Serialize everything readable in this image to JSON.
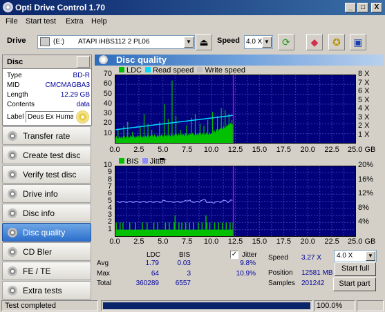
{
  "window": {
    "title": "Opti Drive Control 1.70",
    "min_label": "_",
    "max_label": "□",
    "close_label": "X"
  },
  "menu": [
    "File",
    "Start test",
    "Extra",
    "Help"
  ],
  "toolbar": {
    "drive_label": "Drive",
    "drive_letter": "(E:)",
    "drive_name": "ATAPI  iHBS112   2 PL06",
    "speed_label": "Speed",
    "speed_value": "4.0 X"
  },
  "disc": {
    "header": "Disc",
    "rows": [
      {
        "k": "Type",
        "v": "BD-R"
      },
      {
        "k": "MID",
        "v": "CMCMAGBA3"
      },
      {
        "k": "Length",
        "v": "12.29 GB"
      },
      {
        "k": "Contents",
        "v": "data"
      }
    ],
    "label_caption": "Label",
    "label_value": "Deus Ex Huma"
  },
  "nav": [
    {
      "label": "Transfer rate",
      "active": false
    },
    {
      "label": "Create test disc",
      "active": false
    },
    {
      "label": "Verify test disc",
      "active": false
    },
    {
      "label": "Drive info",
      "active": false
    },
    {
      "label": "Disc info",
      "active": false
    },
    {
      "label": "Disc quality",
      "active": true
    },
    {
      "label": "CD Bler",
      "active": false
    },
    {
      "label": "FE / TE",
      "active": false
    },
    {
      "label": "Extra tests",
      "active": false
    }
  ],
  "panel_title": "Disc quality",
  "colors": {
    "chart_bg": "#00007a",
    "ldc": "#00c000",
    "read": "#00d8ff",
    "write": "#c0c0c0",
    "bis": "#00c000",
    "jitter": "#8c8cff",
    "marker": "#d000d0",
    "grid": "#3a3ab0"
  },
  "chart_data": [
    {
      "type": "bar",
      "legend": [
        {
          "name": "LDC"
        },
        {
          "name": "Read speed"
        },
        {
          "name": "Write speed"
        }
      ],
      "x_range": [
        0,
        25
      ],
      "x_ticks": [
        "0.0",
        "2.5",
        "5.0",
        "7.5",
        "10.0",
        "12.5",
        "15.0",
        "17.5",
        "20.0",
        "22.5",
        "25.0 GB"
      ],
      "y_range": [
        0,
        70
      ],
      "y_ticks": [
        "70",
        "60",
        "50",
        "40",
        "30",
        "20",
        "10"
      ],
      "y2_range": [
        0,
        8
      ],
      "y2_ticks": [
        "8 X",
        "7 X",
        "6 X",
        "5 X",
        "4 X",
        "3 X",
        "2 X",
        "1 X"
      ],
      "data_end": 12.29,
      "ldc_profile": {
        "base_start": 5,
        "base_end": 10,
        "tail_end": 20
      },
      "ldc_spikes": [
        [
          0.3,
          15
        ],
        [
          0.9,
          18
        ],
        [
          1.3,
          22
        ],
        [
          1.8,
          12
        ],
        [
          2.6,
          18
        ],
        [
          3.0,
          30
        ],
        [
          3.4,
          20
        ],
        [
          3.8,
          14
        ],
        [
          4.6,
          22
        ],
        [
          5.1,
          40
        ],
        [
          5.5,
          25
        ],
        [
          5.9,
          64
        ],
        [
          6.3,
          28
        ],
        [
          6.8,
          14
        ],
        [
          7.4,
          18
        ],
        [
          7.9,
          26
        ],
        [
          8.3,
          30
        ],
        [
          8.8,
          20
        ],
        [
          9.2,
          18
        ],
        [
          9.6,
          24
        ],
        [
          10.1,
          32
        ],
        [
          10.6,
          28
        ],
        [
          11.0,
          36
        ],
        [
          11.4,
          34
        ],
        [
          11.8,
          30
        ],
        [
          12.1,
          24
        ]
      ],
      "read_speed": [
        [
          0,
          1.6
        ],
        [
          12.29,
          3.27
        ]
      ]
    },
    {
      "type": "bar",
      "legend": [
        {
          "name": "BIS"
        },
        {
          "name": "Jitter"
        }
      ],
      "x_range": [
        0,
        25
      ],
      "x_ticks": [
        "0.0",
        "2.5",
        "5.0",
        "7.5",
        "10.0",
        "12.5",
        "15.0",
        "17.5",
        "20.0",
        "22.5",
        "25.0 GB"
      ],
      "y_range": [
        0,
        10
      ],
      "y_ticks": [
        "10",
        "9",
        "8",
        "7",
        "6",
        "5",
        "4",
        "3",
        "2",
        "1"
      ],
      "y2_range": [
        0,
        20
      ],
      "y2_ticks": [
        "20%",
        "16%",
        "12%",
        "8%",
        "4%"
      ],
      "data_end": 12.29,
      "bis_low": 1,
      "bis_high": 2,
      "bis_high_at": [
        0.1,
        0.5,
        0.8,
        1.5,
        2.1,
        2.8,
        3.3,
        4.0,
        4.4,
        5.2,
        5.6,
        6.1,
        6.6,
        6.9,
        7.3,
        7.7,
        8.1,
        8.6,
        9.0,
        9.5,
        9.8,
        10.3,
        10.7,
        11.1,
        11.5,
        11.9,
        12.2
      ],
      "bis_peak": [
        [
          6.2,
          3
        ],
        [
          9.4,
          3
        ]
      ],
      "jitter_level": 9.8,
      "jitter_bumps": [
        [
          5.2,
          0.3
        ],
        [
          7.5,
          0.4
        ],
        [
          9.1,
          0.5
        ],
        [
          10.0,
          -0.2
        ],
        [
          11.3,
          0.3
        ],
        [
          12.2,
          0.4
        ]
      ]
    }
  ],
  "stats": {
    "col_ldc": "LDC",
    "col_bis": "BIS",
    "jitter_label": "Jitter",
    "rows": [
      {
        "k": "Avg",
        "ldc": "1.79",
        "bis": "0.03",
        "jit": "9.8%"
      },
      {
        "k": "Max",
        "ldc": "64",
        "bis": "3",
        "jit": "10.9%"
      },
      {
        "k": "Total",
        "ldc": "360289",
        "bis": "6557",
        "jit": ""
      }
    ],
    "speed_label": "Speed",
    "speed_value": "3.27 X",
    "speed_select": "4.0 X",
    "position_label": "Position",
    "position_value": "12581 MB",
    "samples_label": "Samples",
    "samples_value": "201242",
    "start_full": "Start full",
    "start_part": "Start part"
  },
  "status": {
    "text": "Test completed",
    "progress_pct": 100,
    "progress_text": "100.0%"
  }
}
